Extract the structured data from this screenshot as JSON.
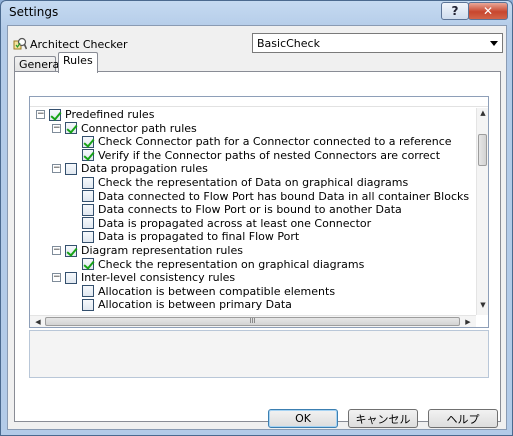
{
  "window": {
    "title": "Settings",
    "help_glyph": "?",
    "close_glyph": "✕"
  },
  "checker": {
    "label": "Architect Checker",
    "selected": "BasicCheck",
    "icon": "checker-icon"
  },
  "tabs": [
    {
      "label": "General",
      "active": false
    },
    {
      "label": "Rules",
      "active": true
    }
  ],
  "tree": [
    {
      "label": "Predefined rules",
      "level": 0,
      "expander": true,
      "checked": true
    },
    {
      "label": "Connector path rules",
      "level": 1,
      "expander": true,
      "checked": true
    },
    {
      "label": "Check Connector path for a Connector connected to a reference",
      "level": 2,
      "expander": false,
      "checked": true
    },
    {
      "label": "Verify if the Connector paths of nested Connectors are correct",
      "level": 2,
      "expander": false,
      "checked": true
    },
    {
      "label": "Data propagation rules",
      "level": 1,
      "expander": true,
      "checked": false
    },
    {
      "label": "Check the representation of Data on graphical diagrams",
      "level": 2,
      "expander": false,
      "checked": false
    },
    {
      "label": "Data connected to Flow Port has bound Data in all container Blocks",
      "level": 2,
      "expander": false,
      "checked": false
    },
    {
      "label": "Data connects to Flow Port or is bound to another Data",
      "level": 2,
      "expander": false,
      "checked": false
    },
    {
      "label": "Data is propagated across at least one Connector",
      "level": 2,
      "expander": false,
      "checked": false
    },
    {
      "label": "Data is propagated to final Flow Port",
      "level": 2,
      "expander": false,
      "checked": false
    },
    {
      "label": "Diagram representation rules",
      "level": 1,
      "expander": true,
      "checked": true
    },
    {
      "label": "Check the representation on graphical diagrams",
      "level": 2,
      "expander": false,
      "checked": true
    },
    {
      "label": "Inter-level consistency rules",
      "level": 1,
      "expander": true,
      "checked": false
    },
    {
      "label": "Allocation is between compatible elements",
      "level": 2,
      "expander": false,
      "checked": false
    },
    {
      "label": "Allocation is between primary Data",
      "level": 2,
      "expander": false,
      "checked": false
    }
  ],
  "expander_glyph": "−",
  "scroll": {
    "hthumb_grip": "III",
    "up": "▲",
    "down": "▼",
    "left": "◀",
    "right": "▶"
  },
  "buttons": {
    "ok": "OK",
    "cancel": "キャンセル",
    "help": "ヘルプ"
  },
  "colors": {
    "check": "#17a317",
    "title_bar": "#b3cbe8",
    "close": "#c8462e"
  }
}
